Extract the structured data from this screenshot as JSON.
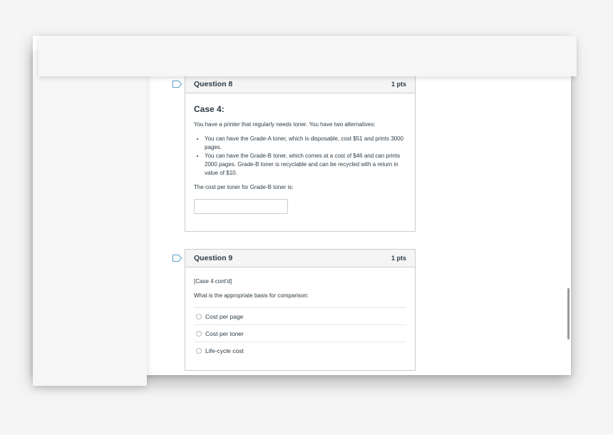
{
  "questions": [
    {
      "name": "Question 8",
      "points": "1 pts",
      "case_title": "Case 4:",
      "intro": "You have a printer that regularly needs toner. You have two alternatives:",
      "bullets": [
        "You can have the Grade-A toner, which is disposable, cost $51 and prints 3000 pages.",
        "You can have the Grade-B toner, which comes at a cost of $46 and can prints 2000 pages. Grade-B toner is recyclable and can be recycled with a return in value of $10."
      ],
      "prompt": "The cost per toner for Grade-B toner is:",
      "answer_value": ""
    },
    {
      "name": "Question 9",
      "points": "1 pts",
      "context": "[Case 4 cont'd]",
      "prompt": "What is the appropriate basis for comparison:",
      "options": [
        "Cost per page",
        "Cost per toner",
        "Life-cycle cost"
      ]
    }
  ],
  "icons": {
    "flag": "flag-bookmark-icon",
    "radio": "radio-unselected-icon"
  },
  "colors": {
    "flag_stroke": "#5b9fc6",
    "border": "#c7cdd1",
    "header_bg": "#f5f5f5"
  }
}
